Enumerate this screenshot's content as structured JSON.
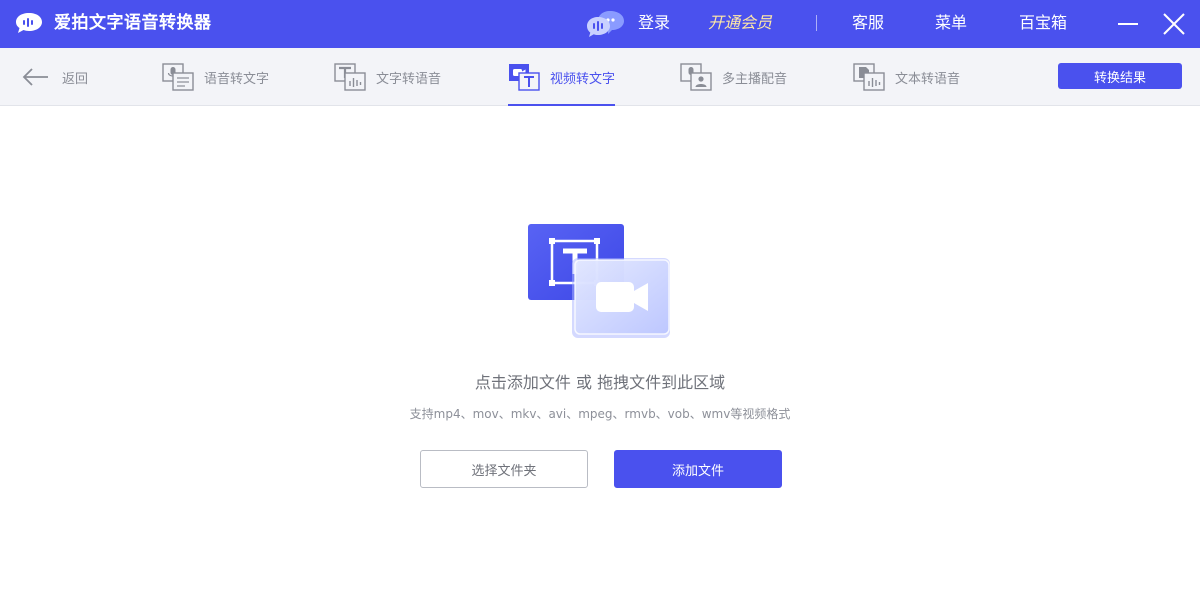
{
  "app": {
    "title": "爱拍文字语音转换器",
    "login_label": "登录",
    "vip_label": "开通会员",
    "service_label": "客服",
    "menu_label": "菜单",
    "toolbox_label": "百宝箱"
  },
  "nav": {
    "back_label": "返回",
    "tabs": [
      {
        "label": "语音转文字",
        "icon": "speech-to-text-icon"
      },
      {
        "label": "文字转语音",
        "icon": "text-to-speech-icon"
      },
      {
        "label": "视频转文字",
        "icon": "video-to-text-icon",
        "active": true
      },
      {
        "label": "多主播配音",
        "icon": "multi-voice-icon"
      },
      {
        "label": "文本转语音",
        "icon": "document-to-speech-icon"
      }
    ],
    "result_label": "转换结果"
  },
  "dropzone": {
    "title": "点击添加文件 或 拖拽文件到此区域",
    "subtitle": "支持mp4、mov、mkv、avi、mpeg、rmvb、vob、wmv等视频格式",
    "select_folder_label": "选择文件夹",
    "add_file_label": "添加文件"
  },
  "colors": {
    "accent": "#4a51ee",
    "vip": "#ffe8a6",
    "nav_bg": "#f3f4f8"
  }
}
